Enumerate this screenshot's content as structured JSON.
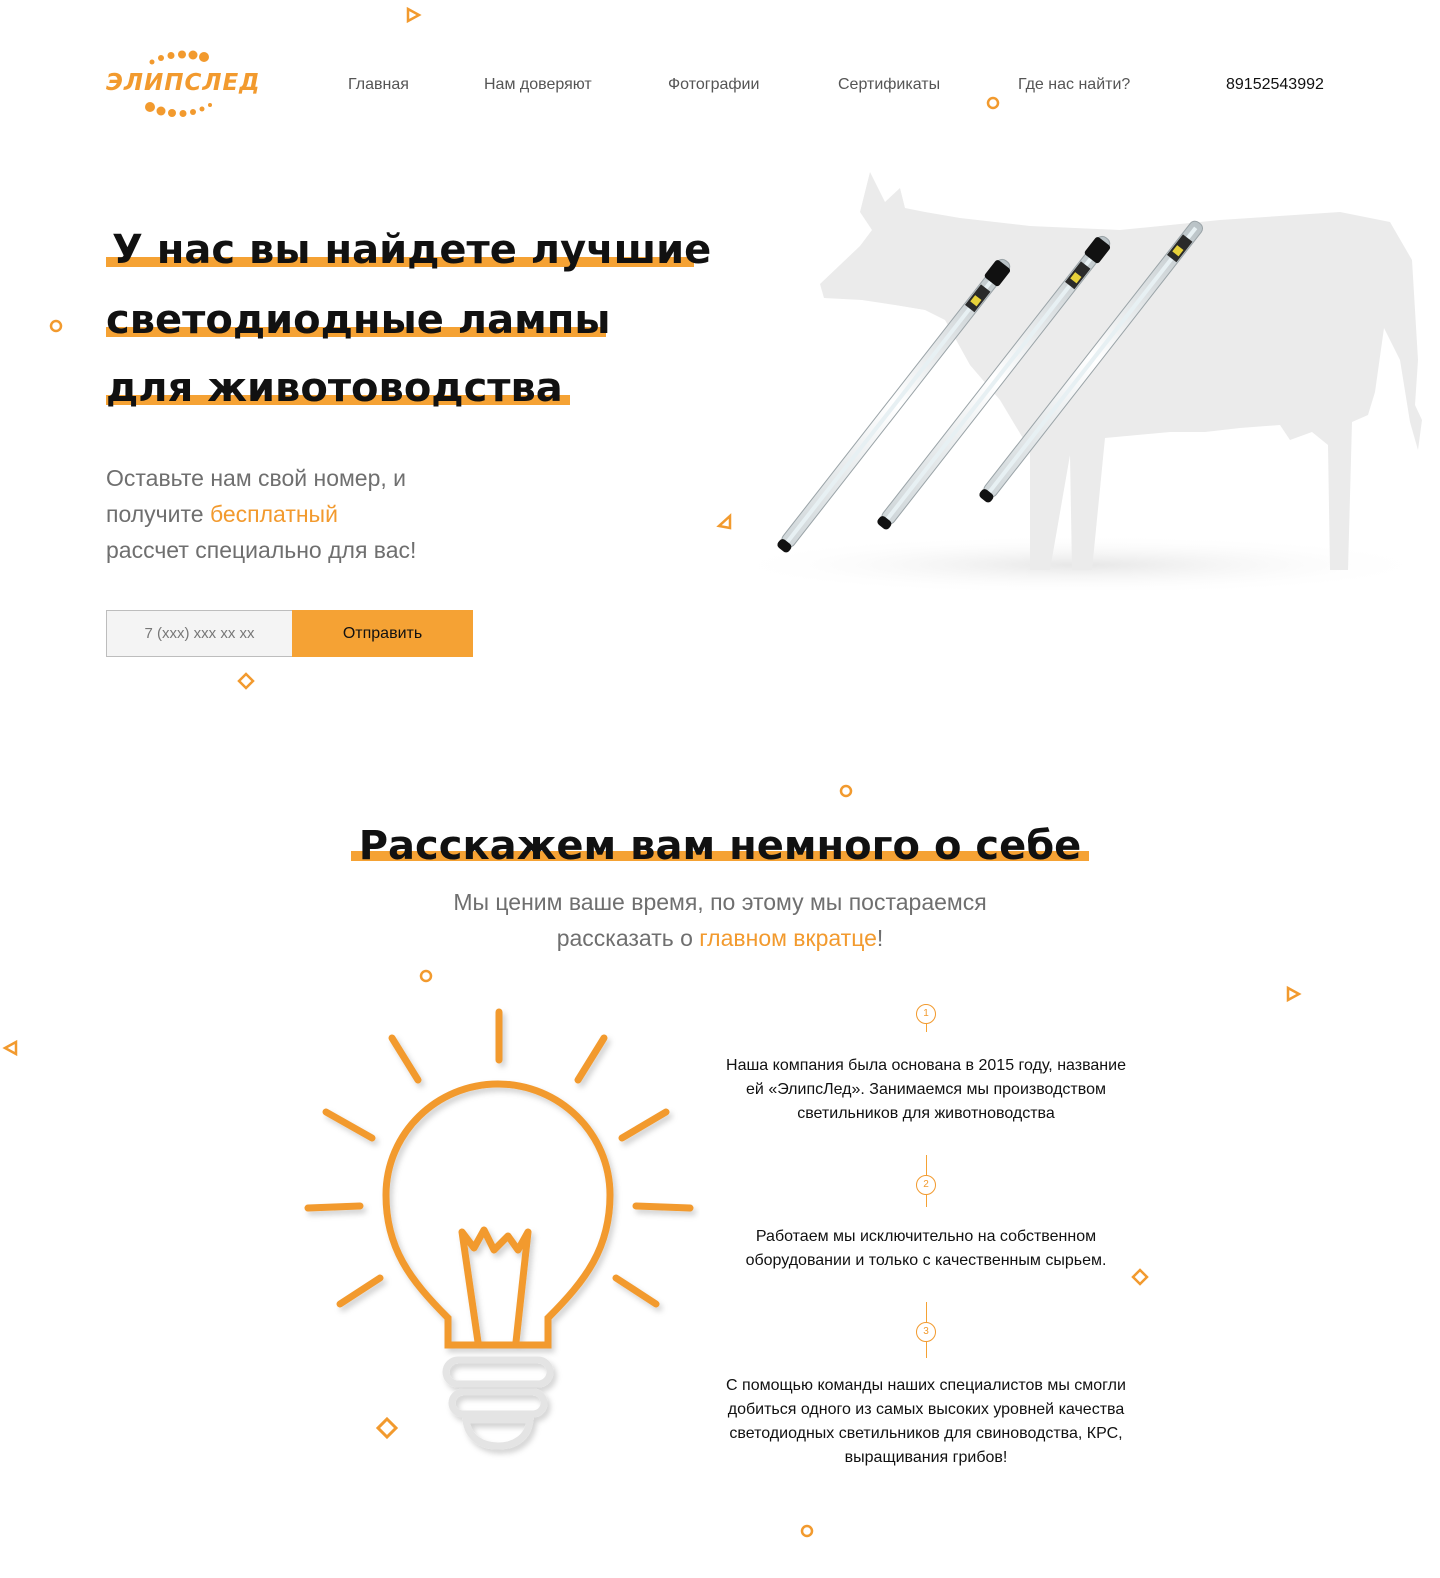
{
  "header": {
    "logo_text": "ЭЛИПСЛЕД",
    "nav": [
      "Главная",
      "Нам доверяют",
      "Фотографии",
      "Сертификаты",
      "Где нас найти?"
    ],
    "phone": "89152543992"
  },
  "hero": {
    "title_lines": [
      "У нас вы найдете лучшие",
      "светодиодные лампы",
      "для животоводства"
    ],
    "sub_1": "Оставьте нам свой номер, и",
    "sub_2a": "получите ",
    "sub_2b": "бесплатный",
    "sub_3": "рассчет специально для вас!",
    "input_placeholder": "7 (xxx) xxx xx xx",
    "button_label": "Отправить"
  },
  "about": {
    "title": "Расскажем вам немного о себе",
    "sub_1": "Мы ценим ваше время, по этому мы постараемся",
    "sub_2a": "рассказать о ",
    "sub_2b": "главном вкратце",
    "sub_2c": "!",
    "steps": [
      {
        "num": "1",
        "text": "Наша компания была основана в 2015 году, название ей «ЭлипсЛед». Занимаемся мы производством светильников для животноводства"
      },
      {
        "num": "2",
        "text": "Работаем мы исключительно на собственном оборудовании и только с качественным сырьем."
      },
      {
        "num": "3",
        "text": "С помощью команды наших специалистов мы смогли добиться одного из самых высоких уровней качества светодиодных светильников для свиноводства, КРС, выращивания грибов!"
      }
    ]
  },
  "colors": {
    "accent": "#f5a234",
    "text": "#111111",
    "muted": "#6f6f6f"
  }
}
